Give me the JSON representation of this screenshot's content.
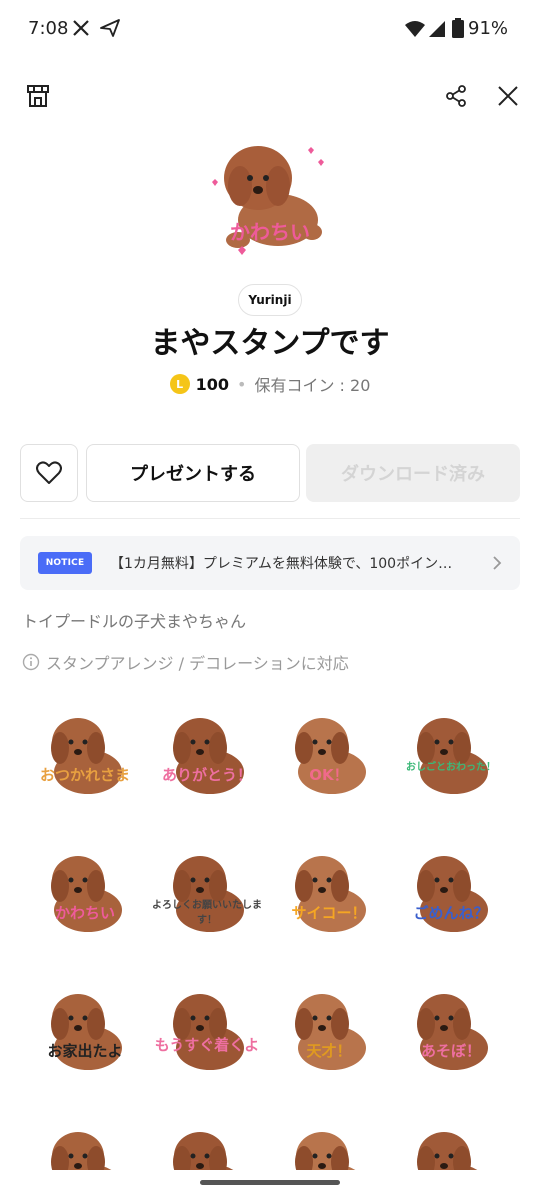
{
  "status_bar": {
    "time": "7:08",
    "battery": "91%"
  },
  "sticker_pack": {
    "author": "Yurinji",
    "title": "まやスタンプです",
    "price": "100",
    "owned_coins": "保有コイン : 20",
    "coin_symbol": "L"
  },
  "actions": {
    "present_label": "プレゼントする",
    "download_label": "ダウンロード済み"
  },
  "notice": {
    "badge": "NOTICE",
    "text": "【1カ月無料】プレミアムを無料体験で、100ポイン…"
  },
  "description": "トイプードルの子犬まやちゃん",
  "arrange_note": "スタンプアレンジ / デコレーションに対応",
  "stickers": [
    {
      "label": "おつかれさま",
      "color": "#e8a040"
    },
    {
      "label": "ありがとう！",
      "color": "#ee6fa0"
    },
    {
      "label": "OK！",
      "color": "#f06a8a"
    },
    {
      "label": "おしごとおわった！",
      "color": "#3cb878"
    },
    {
      "label": "かわちい",
      "color": "#ee5b9a"
    },
    {
      "label": "よろしくお願いいたします！",
      "color": "#444444"
    },
    {
      "label": "サイコー！",
      "color": "#f5a623"
    },
    {
      "label": "ごめんね？",
      "color": "#3a5fcd"
    },
    {
      "label": "お家出たよ",
      "color": "#222222"
    },
    {
      "label": "もうすぐ着くよ",
      "color": "#ee6fa0"
    },
    {
      "label": "天才！",
      "color": "#e09a20"
    },
    {
      "label": "あそぼ！",
      "color": "#ee6fa0"
    },
    {
      "label": "",
      "color": "#5aa0e0"
    },
    {
      "label": "",
      "color": "#5aa0e0"
    },
    {
      "label": "",
      "color": "#3a8ad0"
    },
    {
      "label": "",
      "color": "#999999"
    }
  ],
  "hero_label": "かわちい"
}
